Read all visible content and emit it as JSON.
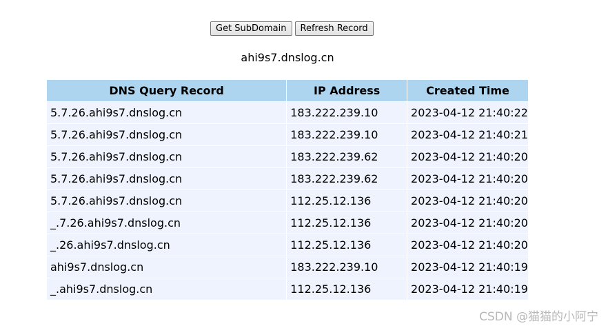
{
  "toolbar": {
    "get_subdomain_label": "Get SubDomain",
    "refresh_record_label": "Refresh Record"
  },
  "subdomain": "ahi9s7.dnslog.cn",
  "table": {
    "headers": [
      "DNS Query Record",
      "IP Address",
      "Created Time"
    ],
    "rows": [
      [
        "5.7.26.ahi9s7.dnslog.cn",
        "183.222.239.10",
        "2023-04-12 21:40:22"
      ],
      [
        "5.7.26.ahi9s7.dnslog.cn",
        "183.222.239.10",
        "2023-04-12 21:40:21"
      ],
      [
        "5.7.26.ahi9s7.dnslog.cn",
        "183.222.239.62",
        "2023-04-12 21:40:20"
      ],
      [
        "5.7.26.ahi9s7.dnslog.cn",
        "183.222.239.62",
        "2023-04-12 21:40:20"
      ],
      [
        "5.7.26.ahi9s7.dnslog.cn",
        "112.25.12.136",
        "2023-04-12 21:40:20"
      ],
      [
        "_.7.26.ahi9s7.dnslog.cn",
        "112.25.12.136",
        "2023-04-12 21:40:20"
      ],
      [
        "_.26.ahi9s7.dnslog.cn",
        "112.25.12.136",
        "2023-04-12 21:40:20"
      ],
      [
        "ahi9s7.dnslog.cn",
        "183.222.239.10",
        "2023-04-12 21:40:19"
      ],
      [
        "_.ahi9s7.dnslog.cn",
        "112.25.12.136",
        "2023-04-12 21:40:19"
      ]
    ]
  },
  "watermark": "CSDN @猫猫的小阿宁",
  "colors": {
    "header_bg": "#aed5f0",
    "row_bg": "#eef3fd"
  }
}
